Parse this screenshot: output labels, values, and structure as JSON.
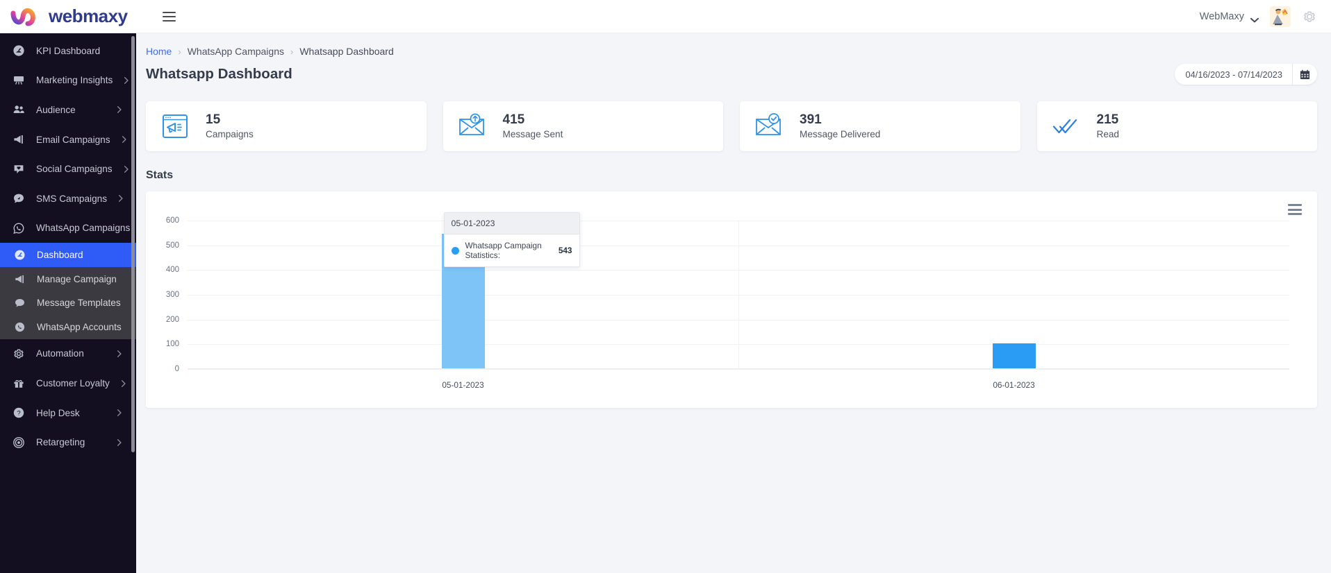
{
  "brand": {
    "name": "webmaxy"
  },
  "topbar": {
    "menu_toggle": "hamburger-menu",
    "user_name": "WebMaxy",
    "settings_label": "Settings"
  },
  "sidebar": {
    "items": [
      {
        "label": "KPI Dashboard",
        "icon": "speedometer-icon",
        "expandable": false
      },
      {
        "label": "Marketing Insights",
        "icon": "presentation-board-icon",
        "expandable": true
      },
      {
        "label": "Audience",
        "icon": "people-icon",
        "expandable": true
      },
      {
        "label": "Email Campaigns",
        "icon": "megaphone-icon",
        "expandable": true
      },
      {
        "label": "Social Campaigns",
        "icon": "chat-heart-icon",
        "expandable": true
      },
      {
        "label": "SMS Campaigns",
        "icon": "sms-bubble-icon",
        "expandable": true
      },
      {
        "label": "WhatsApp Campaigns",
        "icon": "whatsapp-icon",
        "expandable": true,
        "expanded": true
      }
    ],
    "submenu": [
      {
        "label": "Dashboard",
        "icon": "speedometer-icon",
        "active": true
      },
      {
        "label": "Manage Campaign",
        "icon": "megaphone-icon",
        "active": false
      },
      {
        "label": "Message Templates",
        "icon": "chat-bubble-icon",
        "active": false
      },
      {
        "label": "WhatsApp Accounts",
        "icon": "whatsapp-icon",
        "active": false
      }
    ],
    "items_after": [
      {
        "label": "Automation",
        "icon": "gear-icon",
        "expandable": true
      },
      {
        "label": "Customer Loyalty",
        "icon": "gift-icon",
        "expandable": true
      },
      {
        "label": "Help Desk",
        "icon": "question-circle-icon",
        "expandable": true
      },
      {
        "label": "Retargeting",
        "icon": "target-icon",
        "expandable": true
      }
    ]
  },
  "breadcrumb": {
    "home": "Home",
    "section": "WhatsApp Campaigns",
    "current": "Whatsapp Dashboard",
    "separator": "›"
  },
  "page": {
    "title": "Whatsapp Dashboard",
    "date_range": "04/16/2023 - 07/14/2023",
    "calendar_icon": "calendar-icon"
  },
  "cards": [
    {
      "value": "15",
      "label": "Campaigns",
      "icon": "browser-megaphone-icon"
    },
    {
      "value": "415",
      "label": "Message Sent",
      "icon": "envelope-up-arrow-icon"
    },
    {
      "value": "391",
      "label": "Message Delivered",
      "icon": "envelope-check-icon"
    },
    {
      "value": "215",
      "label": "Read",
      "icon": "double-check-icon"
    }
  ],
  "stats": {
    "heading": "Stats",
    "menu_icon": "hamburger-menu-icon"
  },
  "tooltip": {
    "date": "05-01-2023",
    "series_label": "Whatsapp Campaign Statistics:",
    "value": "543",
    "dot_color": "#2b9cf4"
  },
  "colors": {
    "accent": "#2f5cf6",
    "bar": "#2b9cf4",
    "bar_hover": "#7ec4f7",
    "sidebar_bg": "#130f21",
    "submenu_bg": "#3b3a40",
    "card_icon": "#3294e8"
  },
  "chart_data": {
    "type": "bar",
    "title": "Stats",
    "categories": [
      "05-01-2023",
      "06-01-2023"
    ],
    "series": [
      {
        "name": "Whatsapp Campaign Statistics",
        "values": [
          543,
          100
        ]
      }
    ],
    "xlabel": "",
    "ylabel": "",
    "ylim": [
      0,
      600
    ],
    "yticks": [
      0,
      100,
      200,
      300,
      400,
      500,
      600
    ],
    "grid": true,
    "legend": false,
    "hovered_category": "05-01-2023",
    "hovered_value": 543
  }
}
